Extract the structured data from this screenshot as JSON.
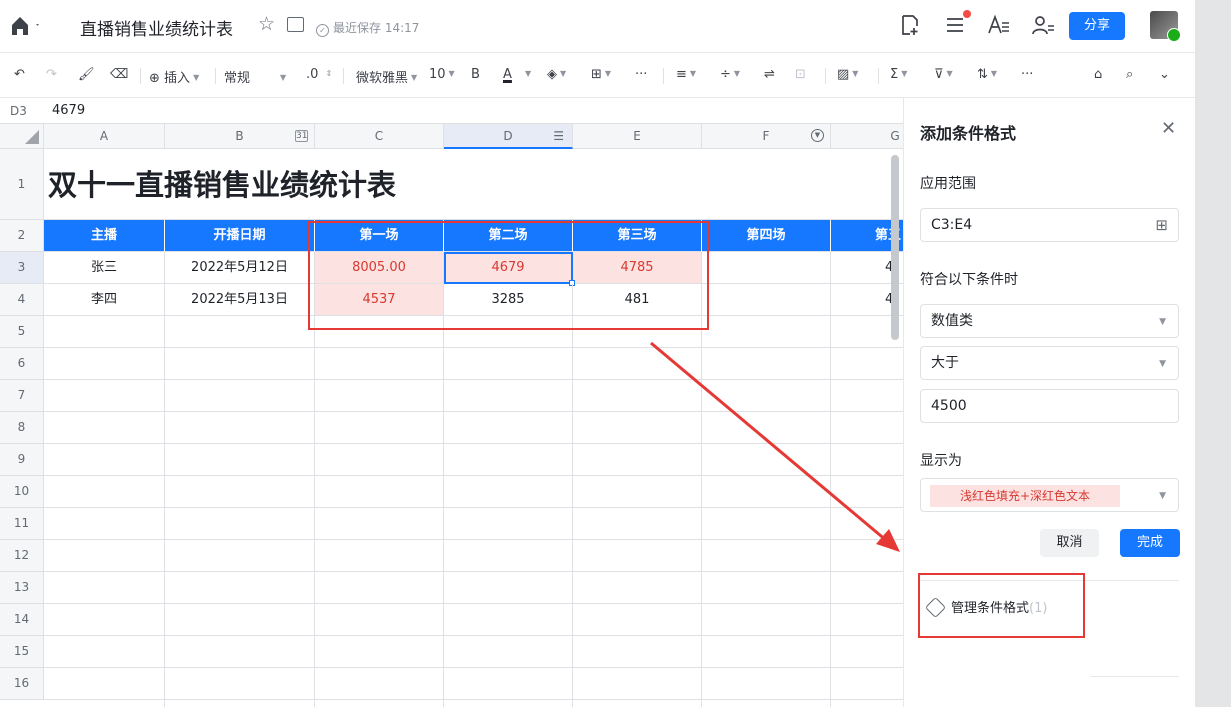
{
  "header": {
    "title": "直播销售业绩统计表",
    "saved_status": "最近保存 14:17",
    "share_label": "分享",
    "icons": [
      "home-icon",
      "star-icon",
      "move-icon",
      "add-doc-icon",
      "menu-icon",
      "font-icon",
      "collaborator-icon"
    ]
  },
  "toolbar": {
    "insert_label": "插入",
    "format_label": "常规",
    "decimal_label": ".0",
    "font_label": "微软雅黑",
    "size_label": "10",
    "bold_label": "B",
    "font_color_label": "A"
  },
  "formula_bar": {
    "cell_ref": "D3",
    "value": "4679"
  },
  "sheet": {
    "columns": [
      "A",
      "B",
      "C",
      "D",
      "E",
      "F",
      "G"
    ],
    "rows": [
      "1",
      "2",
      "3",
      "4",
      "5",
      "6",
      "7",
      "8",
      "9",
      "10",
      "11",
      "12",
      "13",
      "14",
      "15",
      "16"
    ],
    "title": "双十一直播销售业绩统计表",
    "headers": [
      "主播",
      "开播日期",
      "第一场",
      "第二场",
      "第三场",
      "第四场",
      "第五"
    ],
    "data": [
      [
        "张三",
        "2022年5月12日",
        "8005.00",
        "4679",
        "4785",
        "",
        "4"
      ],
      [
        "李四",
        "2022年5月13日",
        "4537",
        "3285",
        "481",
        "",
        "4"
      ]
    ],
    "date_icon_label": "31"
  },
  "panel": {
    "title": "添加条件格式",
    "range_label": "应用范围",
    "range_value": "C3:E4",
    "condition_label": "符合以下条件时",
    "condition_type": "数值类",
    "operator": "大于",
    "threshold": "4500",
    "display_label": "显示为",
    "display_format": "浅红色填充+深红色文本",
    "cancel_label": "取消",
    "done_label": "完成",
    "manage_label": "管理条件格式",
    "manage_count": "(1)"
  },
  "colors": {
    "accent": "#1677ff",
    "highlight_fill": "#fde2e2",
    "highlight_text": "#d83931",
    "annotation": "#e53935"
  }
}
